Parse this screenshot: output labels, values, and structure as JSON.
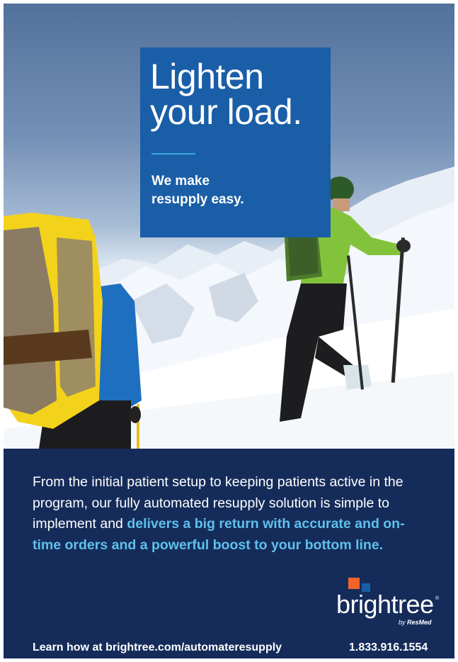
{
  "headline": {
    "title": "Lighten\nyour load.",
    "tagline": "We make\nresupply easy."
  },
  "body": {
    "text": "From the initial patient setup to keeping patients active in the program, our fully automated resupply solution is simple to implement and ",
    "highlight": "delivers a big return with accurate and on-time orders and a powerful boost to your bottom line."
  },
  "logo": {
    "wordmark": "brightree",
    "registered": "®",
    "by": "by",
    "parent": "ResMed"
  },
  "footer": {
    "learn_more": "Learn how at brightree.com/automateresupply",
    "phone": "1.833.916.1554"
  },
  "colors": {
    "headline_box": "#1a5ea7",
    "panel": "#152c5a",
    "accent_text": "#5fc0ec",
    "logo_orange": "#f0642b",
    "logo_blue": "#1a5ea7"
  }
}
